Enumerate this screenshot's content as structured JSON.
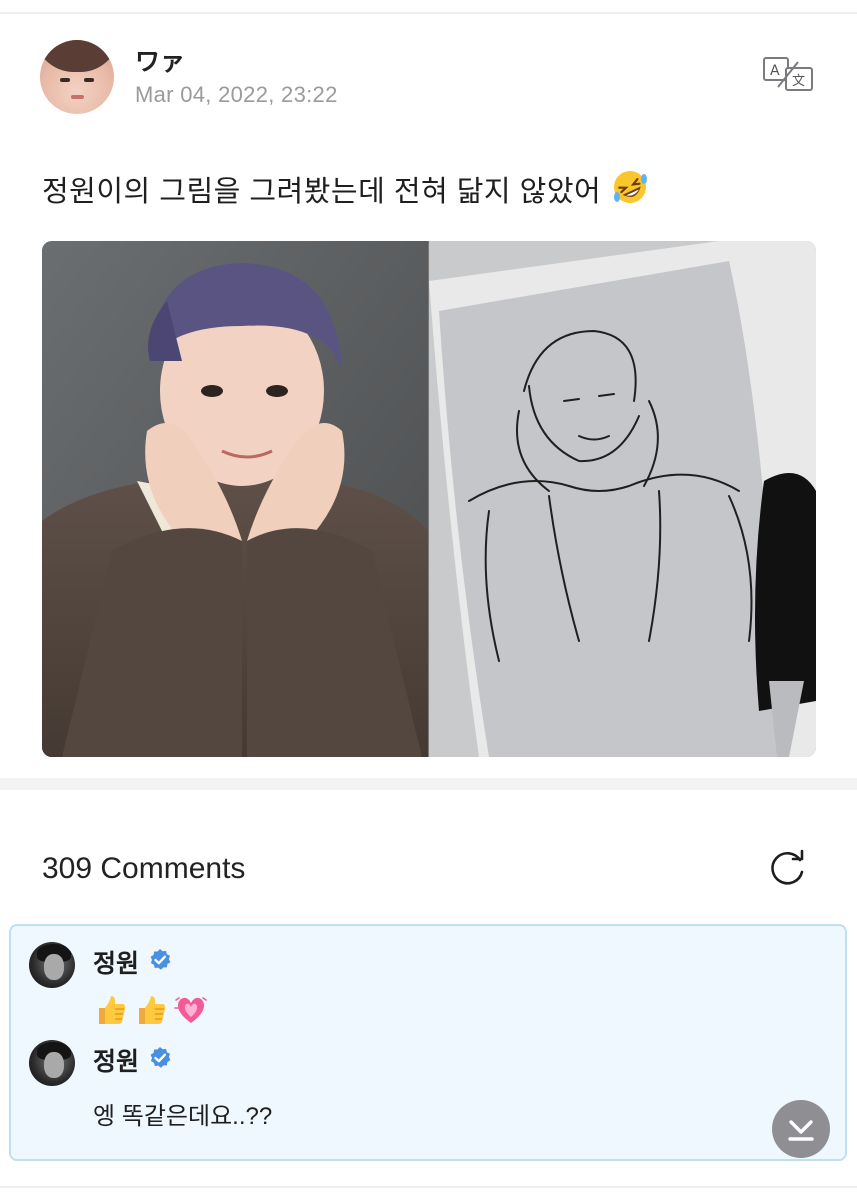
{
  "post": {
    "author_name": "ワァ",
    "date": "Mar 04, 2022, 23:22",
    "text": "정원이의 그림을 그려봤는데 전혀 닮지 않았어",
    "text_emoji": "rolling-on-floor-laughing-icon",
    "images": [
      "photo-of-person",
      "pen-drawing-on-napkin"
    ]
  },
  "comments": {
    "title": "309 Comments",
    "items": [
      {
        "name": "정원",
        "verified": true,
        "content_emojis": [
          "thumbs-up-icon",
          "thumbs-up-icon",
          "growing-heart-icon"
        ]
      },
      {
        "name": "정원",
        "verified": true,
        "text": "엥 똑같은데요..??"
      }
    ]
  },
  "colors": {
    "accent_verified": "#4a90e2",
    "thread_bg": "#eef8fe",
    "thread_border": "#bfe0f3",
    "date_gray": "#9a9a9f"
  }
}
